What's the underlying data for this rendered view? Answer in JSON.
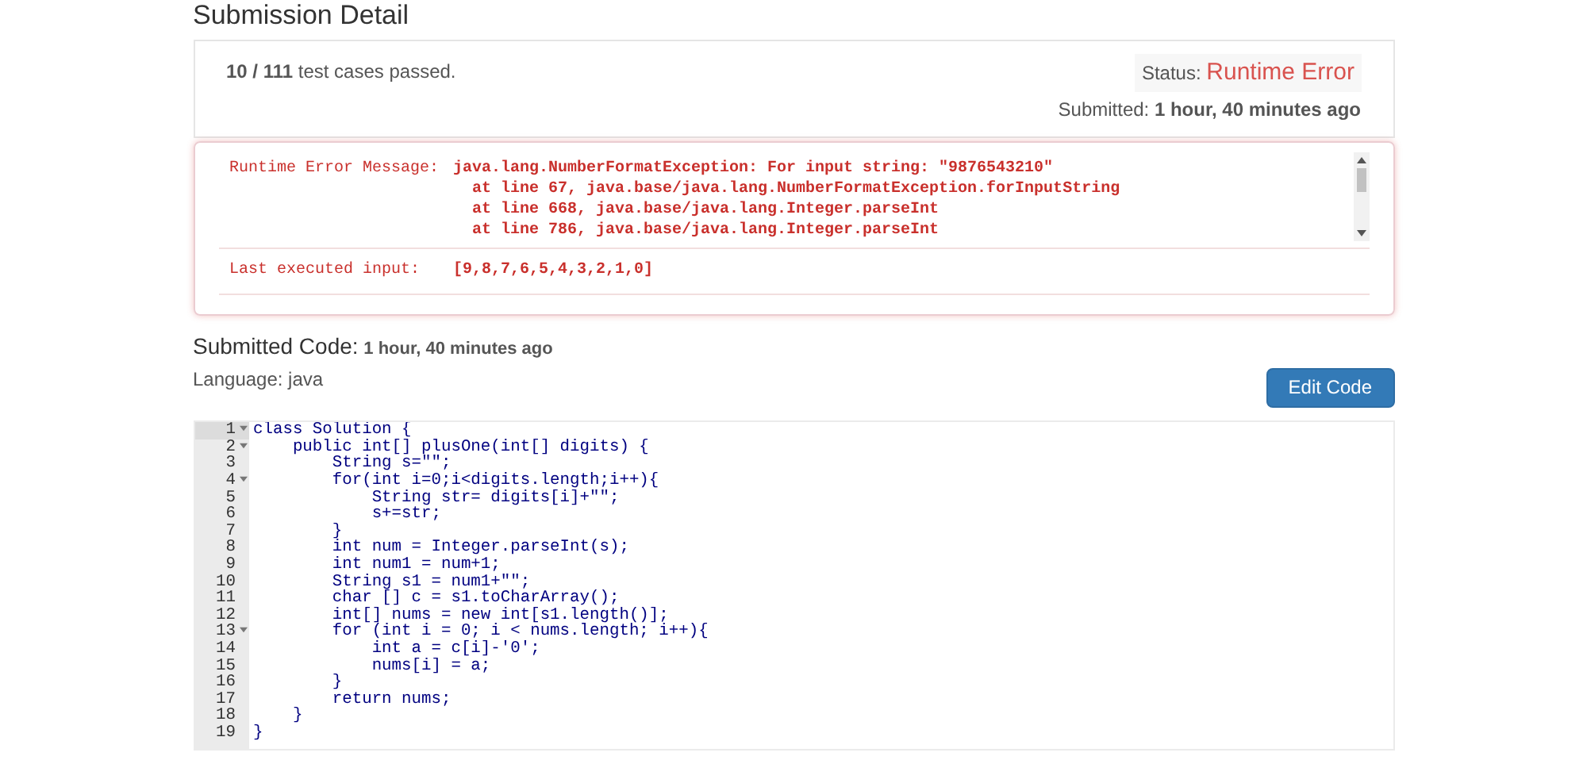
{
  "title": "Submission Detail",
  "summary": {
    "passed": "10 / 111",
    "passed_label": "test cases passed.",
    "status_label": "Status:",
    "status": "Runtime Error",
    "submitted_label": "Submitted:",
    "submitted": "1 hour, 40 minutes ago"
  },
  "error": {
    "message_label": "Runtime Error Message:",
    "message_lines": [
      "java.lang.NumberFormatException: For input string: \"9876543210\"",
      "  at line 67, java.base/java.lang.NumberFormatException.forInputString",
      "  at line 668, java.base/java.lang.Integer.parseInt",
      "  at line 786, java.base/java.lang.Integer.parseInt"
    ],
    "input_label": "Last executed input:",
    "input": "[9,8,7,6,5,4,3,2,1,0]"
  },
  "code_header": {
    "title": "Submitted Code:",
    "time": "1 hour, 40 minutes ago",
    "language": "Language: java",
    "button": "Edit Code"
  },
  "code_lines": [
    {
      "number": "1",
      "foldable": true,
      "active": true,
      "text": "class Solution {"
    },
    {
      "number": "2",
      "foldable": true,
      "active": false,
      "text": "    public int[] plusOne(int[] digits) {"
    },
    {
      "number": "3",
      "foldable": false,
      "active": false,
      "text": "        String s=\"\";"
    },
    {
      "number": "4",
      "foldable": true,
      "active": false,
      "text": "        for(int i=0;i<digits.length;i++){"
    },
    {
      "number": "5",
      "foldable": false,
      "active": false,
      "text": "            String str= digits[i]+\"\";"
    },
    {
      "number": "6",
      "foldable": false,
      "active": false,
      "text": "            s+=str;"
    },
    {
      "number": "7",
      "foldable": false,
      "active": false,
      "text": "        }"
    },
    {
      "number": "8",
      "foldable": false,
      "active": false,
      "text": "        int num = Integer.parseInt(s);"
    },
    {
      "number": "9",
      "foldable": false,
      "active": false,
      "text": "        int num1 = num+1;"
    },
    {
      "number": "10",
      "foldable": false,
      "active": false,
      "text": "        String s1 = num1+\"\";"
    },
    {
      "number": "11",
      "foldable": false,
      "active": false,
      "text": "        char [] c = s1.toCharArray();"
    },
    {
      "number": "12",
      "foldable": false,
      "active": false,
      "text": "        int[] nums = new int[s1.length()];"
    },
    {
      "number": "13",
      "foldable": true,
      "active": false,
      "text": "        for (int i = 0; i < nums.length; i++){"
    },
    {
      "number": "14",
      "foldable": false,
      "active": false,
      "text": "            int a = c[i]-'0';"
    },
    {
      "number": "15",
      "foldable": false,
      "active": false,
      "text": "            nums[i] = a;"
    },
    {
      "number": "16",
      "foldable": false,
      "active": false,
      "text": "        }"
    },
    {
      "number": "17",
      "foldable": false,
      "active": false,
      "text": "        return nums;"
    },
    {
      "number": "18",
      "foldable": false,
      "active": false,
      "text": "    }"
    },
    {
      "number": "19",
      "foldable": false,
      "active": false,
      "text": "}"
    }
  ]
}
